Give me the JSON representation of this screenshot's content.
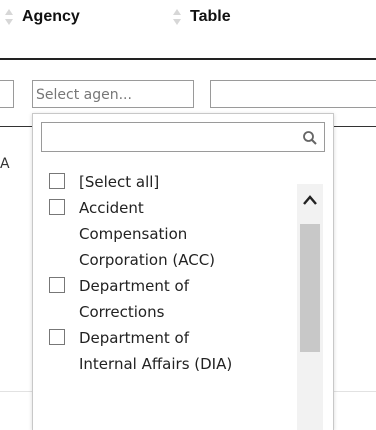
{
  "header": {
    "columns": [
      {
        "label": "Agency"
      },
      {
        "label": "Table"
      }
    ]
  },
  "filters": {
    "agency_placeholder": "Select agen..."
  },
  "row_fragment": "A",
  "dropdown": {
    "search_placeholder": "",
    "options": [
      {
        "label_lines": [
          "[Select all]"
        ],
        "checked": false
      },
      {
        "label_lines": [
          "Accident",
          "Compensation",
          "Corporation (ACC)"
        ],
        "checked": false
      },
      {
        "label_lines": [
          "Department of",
          "Corrections"
        ],
        "checked": false
      },
      {
        "label_lines": [
          "Department of",
          "Internal Affairs (DIA)"
        ],
        "checked": false
      }
    ]
  },
  "icons": {
    "sort": "sort-icon",
    "search": "search-icon",
    "scroll_up": "chevron-up-icon"
  },
  "colors": {
    "border": "#9a9a9a",
    "header_rule": "#222222",
    "scroll_thumb": "#c8c8c8"
  }
}
